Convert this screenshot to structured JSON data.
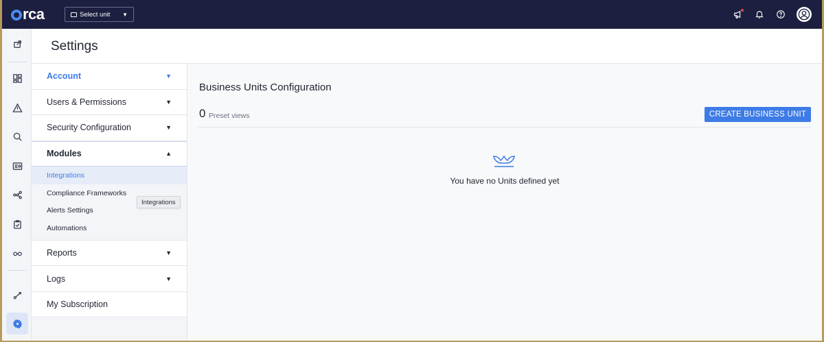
{
  "topbar": {
    "logo_text": "orca",
    "unit_select": "Select unit",
    "icons": [
      "megaphone-icon",
      "bell-icon",
      "help-icon",
      "user-avatar"
    ]
  },
  "header": {
    "title": "Settings"
  },
  "menu": {
    "account": "Account",
    "users": "Users & Permissions",
    "security": "Security Configuration",
    "modules": "Modules",
    "sub": {
      "integrations": "Integrations",
      "compliance": "Compliance Frameworks",
      "alerts": "Alerts Settings",
      "automations": "Automations"
    },
    "reports": "Reports",
    "logs": "Logs",
    "subscription": "My Subscription"
  },
  "tooltip": "Integrations",
  "main": {
    "section_title": "Business Units Configuration",
    "count": "0",
    "count_label": "Preset views",
    "create_button": "CREATE BUSINESS UNIT",
    "empty_text": "You have no Units defined yet"
  },
  "colors": {
    "topbar": "#1c1f3f",
    "accent": "#3d7be6"
  }
}
